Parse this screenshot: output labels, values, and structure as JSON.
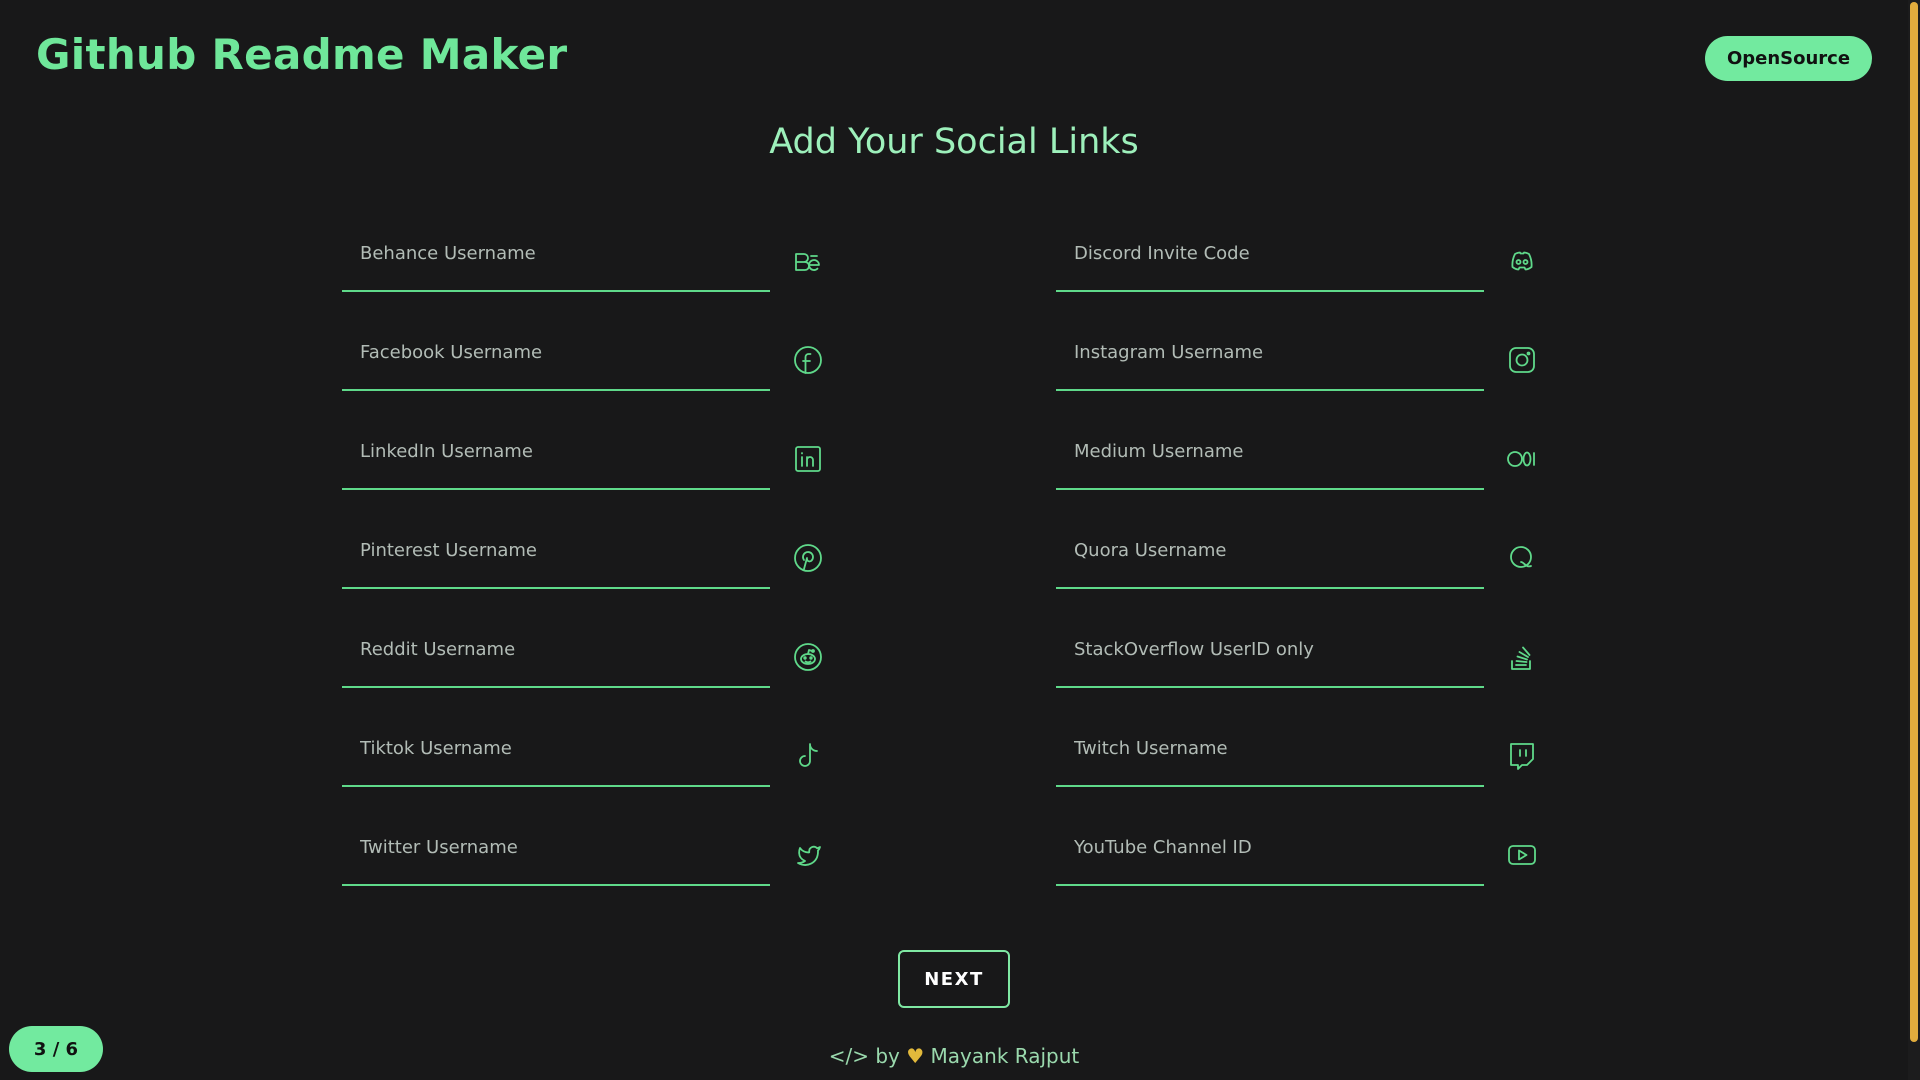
{
  "header": {
    "title": "Github Readme Maker",
    "opensource_label": "OpenSource"
  },
  "main": {
    "heading": "Add Your Social Links",
    "fields": [
      {
        "placeholder": "Behance Username",
        "icon": "behance-icon"
      },
      {
        "placeholder": "Discord Invite Code",
        "icon": "discord-icon"
      },
      {
        "placeholder": "Facebook Username",
        "icon": "facebook-icon"
      },
      {
        "placeholder": "Instagram Username",
        "icon": "instagram-icon"
      },
      {
        "placeholder": "LinkedIn Username",
        "icon": "linkedin-icon"
      },
      {
        "placeholder": "Medium Username",
        "icon": "medium-icon"
      },
      {
        "placeholder": "Pinterest Username",
        "icon": "pinterest-icon"
      },
      {
        "placeholder": "Quora Username",
        "icon": "quora-icon"
      },
      {
        "placeholder": "Reddit Username",
        "icon": "reddit-icon"
      },
      {
        "placeholder": "StackOverflow UserID only",
        "icon": "stackoverflow-icon"
      },
      {
        "placeholder": "Tiktok Username",
        "icon": "tiktok-icon"
      },
      {
        "placeholder": "Twitch Username",
        "icon": "twitch-icon"
      },
      {
        "placeholder": "Twitter Username",
        "icon": "twitter-icon"
      },
      {
        "placeholder": "YouTube Channel ID",
        "icon": "youtube-icon"
      }
    ],
    "next_label": "NEXT"
  },
  "footer": {
    "code_symbol": "</>",
    "by": "by",
    "heart": "♥",
    "author": "Mayank Rajput"
  },
  "progress": {
    "label": "3 / 6"
  },
  "colors": {
    "background": "#181819",
    "accent": "#72ea9f",
    "heart": "#e2b93b"
  }
}
